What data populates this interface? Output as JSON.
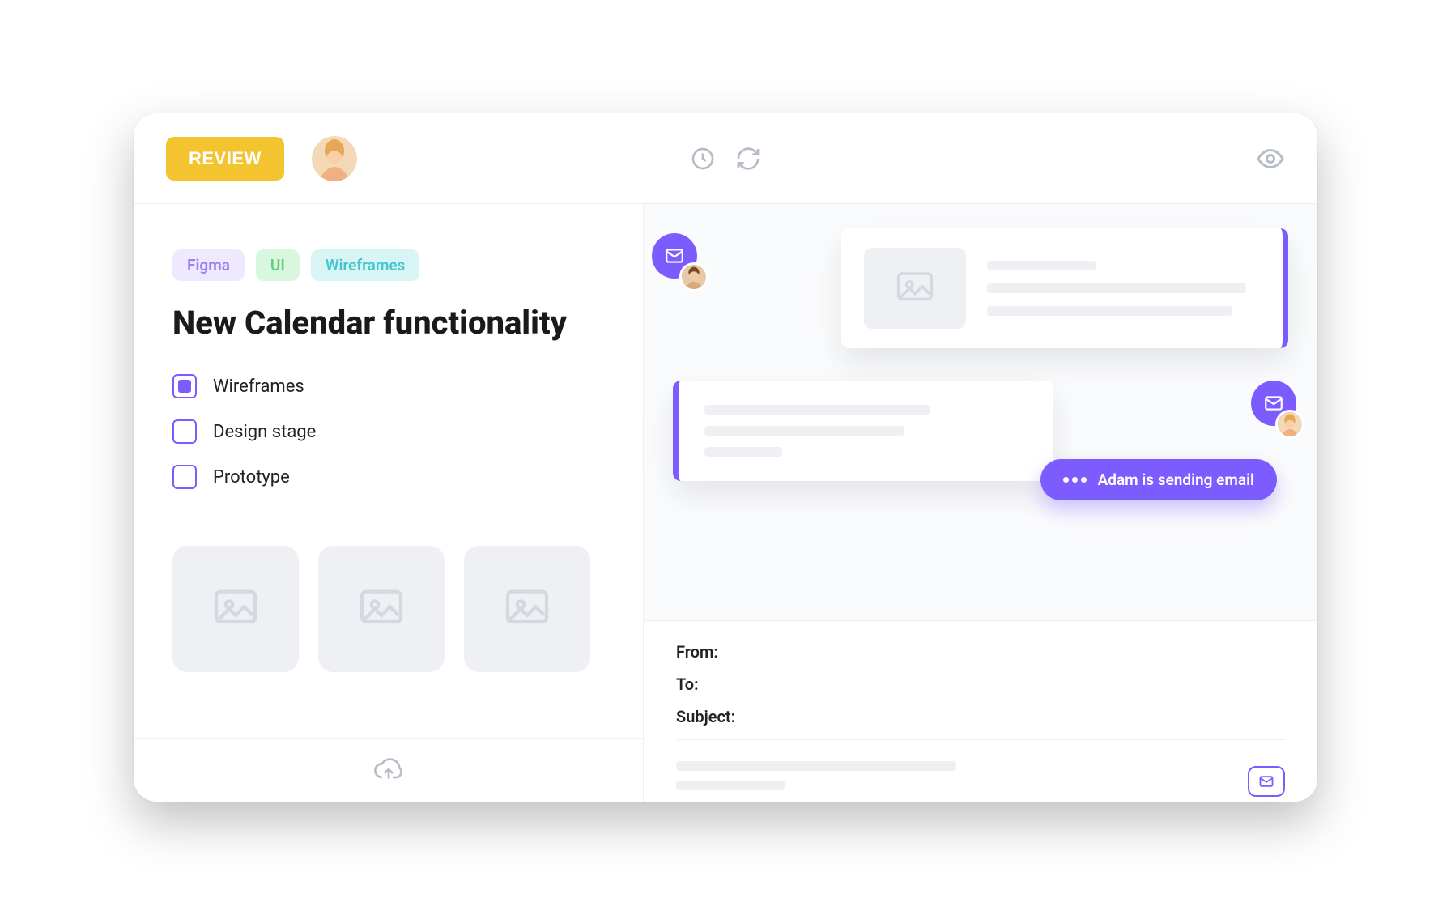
{
  "header": {
    "review_label": "REVIEW"
  },
  "tags": {
    "figma": "Figma",
    "ui": "UI",
    "wireframes": "Wireframes"
  },
  "page_title": "New Calendar functionality",
  "checklist": {
    "items": [
      {
        "label": "Wireframes",
        "checked": true
      },
      {
        "label": "Design stage",
        "checked": false
      },
      {
        "label": "Prototype",
        "checked": false
      }
    ]
  },
  "status_pill": "Adam is sending email",
  "compose": {
    "from_label": "From:",
    "to_label": "To:",
    "subject_label": "Subject:"
  }
}
